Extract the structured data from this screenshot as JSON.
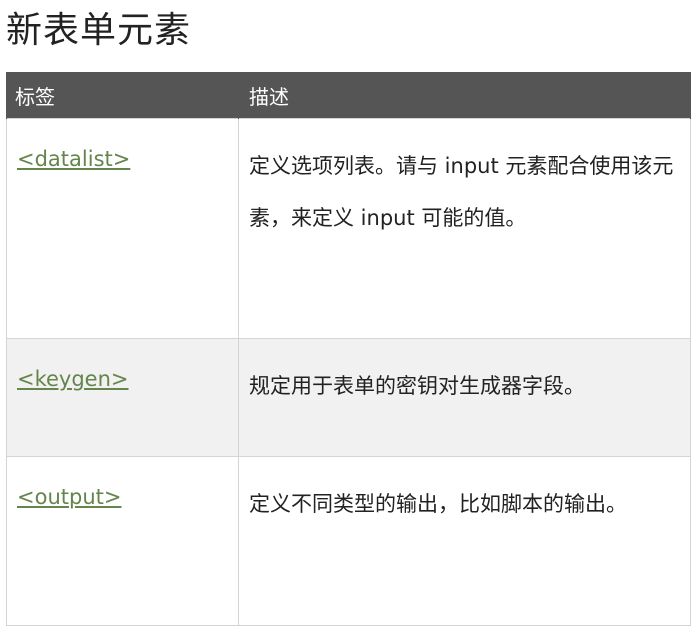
{
  "page": {
    "title": "新表单元素"
  },
  "table": {
    "headers": [
      "标签",
      "描述"
    ],
    "rows": [
      {
        "tag": "<datalist>",
        "description": "定义选项列表。请与 input 元素配合使用该元素，来定义 input 可能的值。"
      },
      {
        "tag": "<keygen>",
        "description": "规定用于表单的密钥对生成器字段。"
      },
      {
        "tag": "<output>",
        "description": "定义不同类型的输出，比如脚本的输出。"
      }
    ]
  },
  "colors": {
    "header_bg": "#555555",
    "link": "#64854c",
    "alt_row_bg": "#f1f1f1",
    "border": "#d4d4d4"
  }
}
